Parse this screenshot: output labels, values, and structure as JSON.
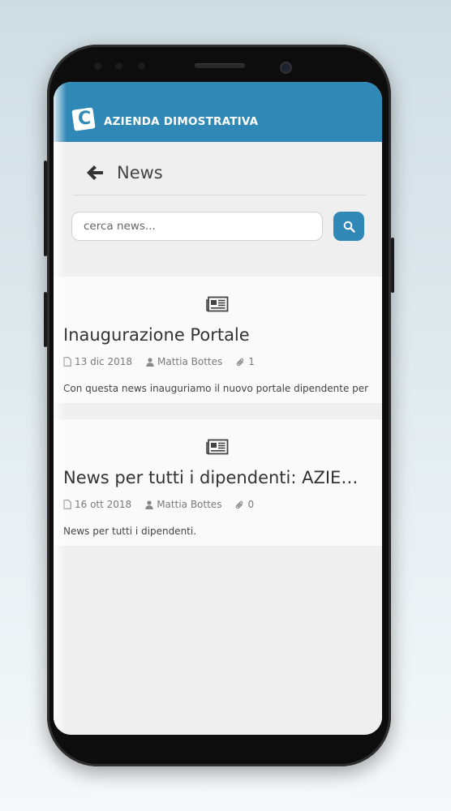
{
  "app": {
    "title": "AZIENDA DIMOSTRATIVA",
    "logo_letter": "C"
  },
  "page": {
    "title": "News"
  },
  "search": {
    "placeholder": "cerca news..."
  },
  "colors": {
    "accent": "#2f88b6",
    "card_bg": "#fafafa",
    "screen_bg": "#efefef"
  },
  "news": [
    {
      "title": "Inaugurazione Portale",
      "date": "13 dic 2018",
      "author": "Mattia Bottes",
      "attachments": "1",
      "excerpt": "Con questa news inauguriamo il nuovo portale dipendente per"
    },
    {
      "title": "News per tutti i dipendenti: AZIENDA DIMOSTRATIVA",
      "date": "16 ott 2018",
      "author": "Mattia Bottes",
      "attachments": "0",
      "excerpt": "News per tutti i dipendenti."
    }
  ]
}
